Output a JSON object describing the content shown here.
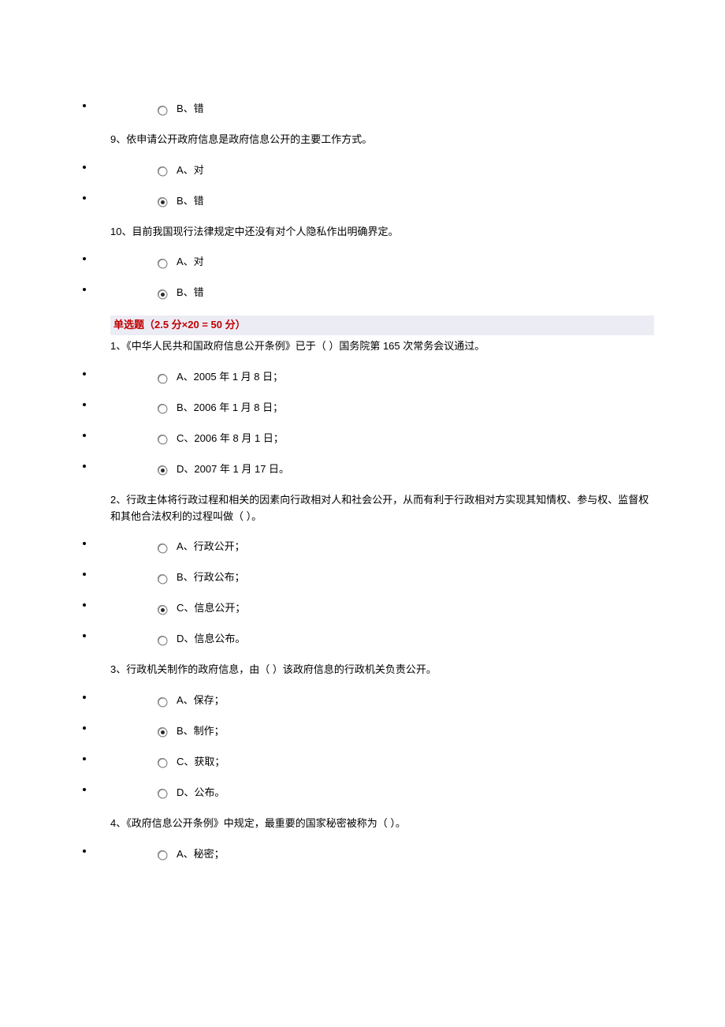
{
  "items": [
    {
      "type": "option",
      "key": "o_8b",
      "label": "B、错",
      "selected": false
    },
    {
      "type": "question",
      "key": "q9",
      "text": "9、依申请公开政府信息是政府信息公开的主要工作方式。"
    },
    {
      "type": "option",
      "key": "o_9a",
      "label": "A、对",
      "selected": false
    },
    {
      "type": "option",
      "key": "o_9b",
      "label": "B、错",
      "selected": true
    },
    {
      "type": "question",
      "key": "q10",
      "text": "10、目前我国现行法律规定中还没有对个人隐私作出明确界定。"
    },
    {
      "type": "option",
      "key": "o_10a",
      "label": "A、对",
      "selected": false
    },
    {
      "type": "option",
      "key": "o_10b",
      "label": "B、错",
      "selected": true
    },
    {
      "type": "section",
      "key": "sec2",
      "text": "单选题（2.5 分×20 = 50 分）"
    },
    {
      "type": "question",
      "key": "s1",
      "text": "1、《中华人民共和国政府信息公开条例》已于（ ）国务院第 165 次常务会议通过。"
    },
    {
      "type": "option",
      "key": "s1a",
      "label": "A、2005 年 1 月 8 日；",
      "selected": false
    },
    {
      "type": "option",
      "key": "s1b",
      "label": "B、2006 年 1 月 8 日；",
      "selected": false
    },
    {
      "type": "option",
      "key": "s1c",
      "label": "C、2006 年 8 月 1 日；",
      "selected": false
    },
    {
      "type": "option",
      "key": "s1d",
      "label": "D、2007 年 1 月 17 日。",
      "selected": true
    },
    {
      "type": "question",
      "key": "s2",
      "text": "2、行政主体将行政过程和相关的因素向行政相对人和社会公开，从而有利于行政相对方实现其知情权、参与权、监督权和其他合法权利的过程叫做（ ）。"
    },
    {
      "type": "option",
      "key": "s2a",
      "label": "A、行政公开；",
      "selected": false
    },
    {
      "type": "option",
      "key": "s2b",
      "label": "B、行政公布；",
      "selected": false
    },
    {
      "type": "option",
      "key": "s2c",
      "label": "C、信息公开；",
      "selected": true
    },
    {
      "type": "option",
      "key": "s2d",
      "label": "D、信息公布。",
      "selected": false
    },
    {
      "type": "question",
      "key": "s3",
      "text": "3、行政机关制作的政府信息，由（ ）该政府信息的行政机关负责公开。"
    },
    {
      "type": "option",
      "key": "s3a",
      "label": "A、保存；",
      "selected": false
    },
    {
      "type": "option",
      "key": "s3b",
      "label": "B、制作；",
      "selected": true
    },
    {
      "type": "option",
      "key": "s3c",
      "label": "C、获取；",
      "selected": false
    },
    {
      "type": "option",
      "key": "s3d",
      "label": "D、公布。",
      "selected": false
    },
    {
      "type": "question",
      "key": "s4",
      "text": "4、《政府信息公开条例》中规定，最重要的国家秘密被称为（ ）。"
    },
    {
      "type": "option",
      "key": "s4a",
      "label": "A、秘密；",
      "selected": false
    }
  ]
}
